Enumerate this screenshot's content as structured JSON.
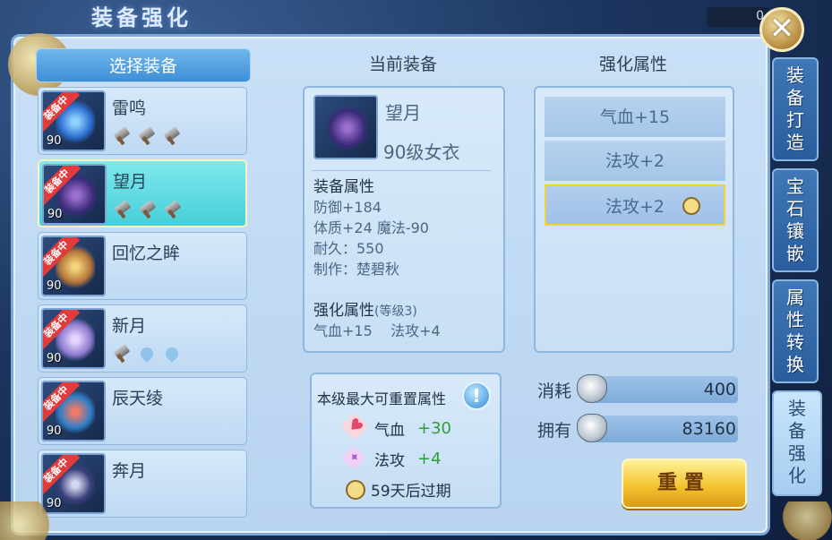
{
  "window": {
    "title": "装备强化",
    "hud_value": "0"
  },
  "left": {
    "header": "选择装备",
    "items": [
      {
        "name": "雷鸣",
        "badge": "装备中",
        "level": "90",
        "gems": [
          "hammer",
          "hammer",
          "hammer"
        ],
        "selected": false
      },
      {
        "name": "望月",
        "badge": "装备中",
        "level": "90",
        "gems": [
          "hammer",
          "hammer",
          "hammer"
        ],
        "selected": true
      },
      {
        "name": "回忆之眸",
        "badge": "装备中",
        "level": "90",
        "gems": [],
        "selected": false
      },
      {
        "name": "新月",
        "badge": "装备中",
        "level": "90",
        "gems": [
          "hammer",
          "empty",
          "empty"
        ],
        "selected": false
      },
      {
        "name": "辰天绫",
        "badge": "装备中",
        "level": "90",
        "gems": [],
        "selected": false
      },
      {
        "name": "奔月",
        "badge": "装备中",
        "level": "90",
        "gems": [],
        "selected": false
      }
    ]
  },
  "middle": {
    "header": "当前装备",
    "item_name": "望月",
    "item_sub": "90级女衣",
    "attr_title": "装备属性",
    "attrs": [
      "防御+184",
      "体质+24 魔法-90",
      "耐久：550",
      "制作：楚碧秋"
    ],
    "enh_title": "强化属性",
    "enh_level": "(等级3)",
    "enh_values": "气血+15    法攻+4"
  },
  "reset_info": {
    "title": "本级最大可重置属性",
    "info_icon": "!",
    "rows": [
      {
        "icon": "heart-icon",
        "label": "气血",
        "value": "+30"
      },
      {
        "icon": "diamond-icon",
        "label": "法攻",
        "value": "+4"
      }
    ],
    "expire": "59天后过期"
  },
  "right": {
    "header": "强化属性",
    "rows": [
      "气血+15",
      "法攻+2",
      "法攻+2"
    ],
    "cost_label": "消耗",
    "cost_value": "400",
    "own_label": "拥有",
    "own_value": "83160",
    "reset_button": "重置"
  },
  "tabs": [
    "装备打造",
    "宝石镶嵌",
    "属性转换",
    "装备强化"
  ],
  "colors": {
    "accent": "#3f8fd6",
    "selected_item": "#47cfd8",
    "badge": "#e43a3a",
    "value_green": "#2f9e3a",
    "button_gold": "#f5c431"
  }
}
